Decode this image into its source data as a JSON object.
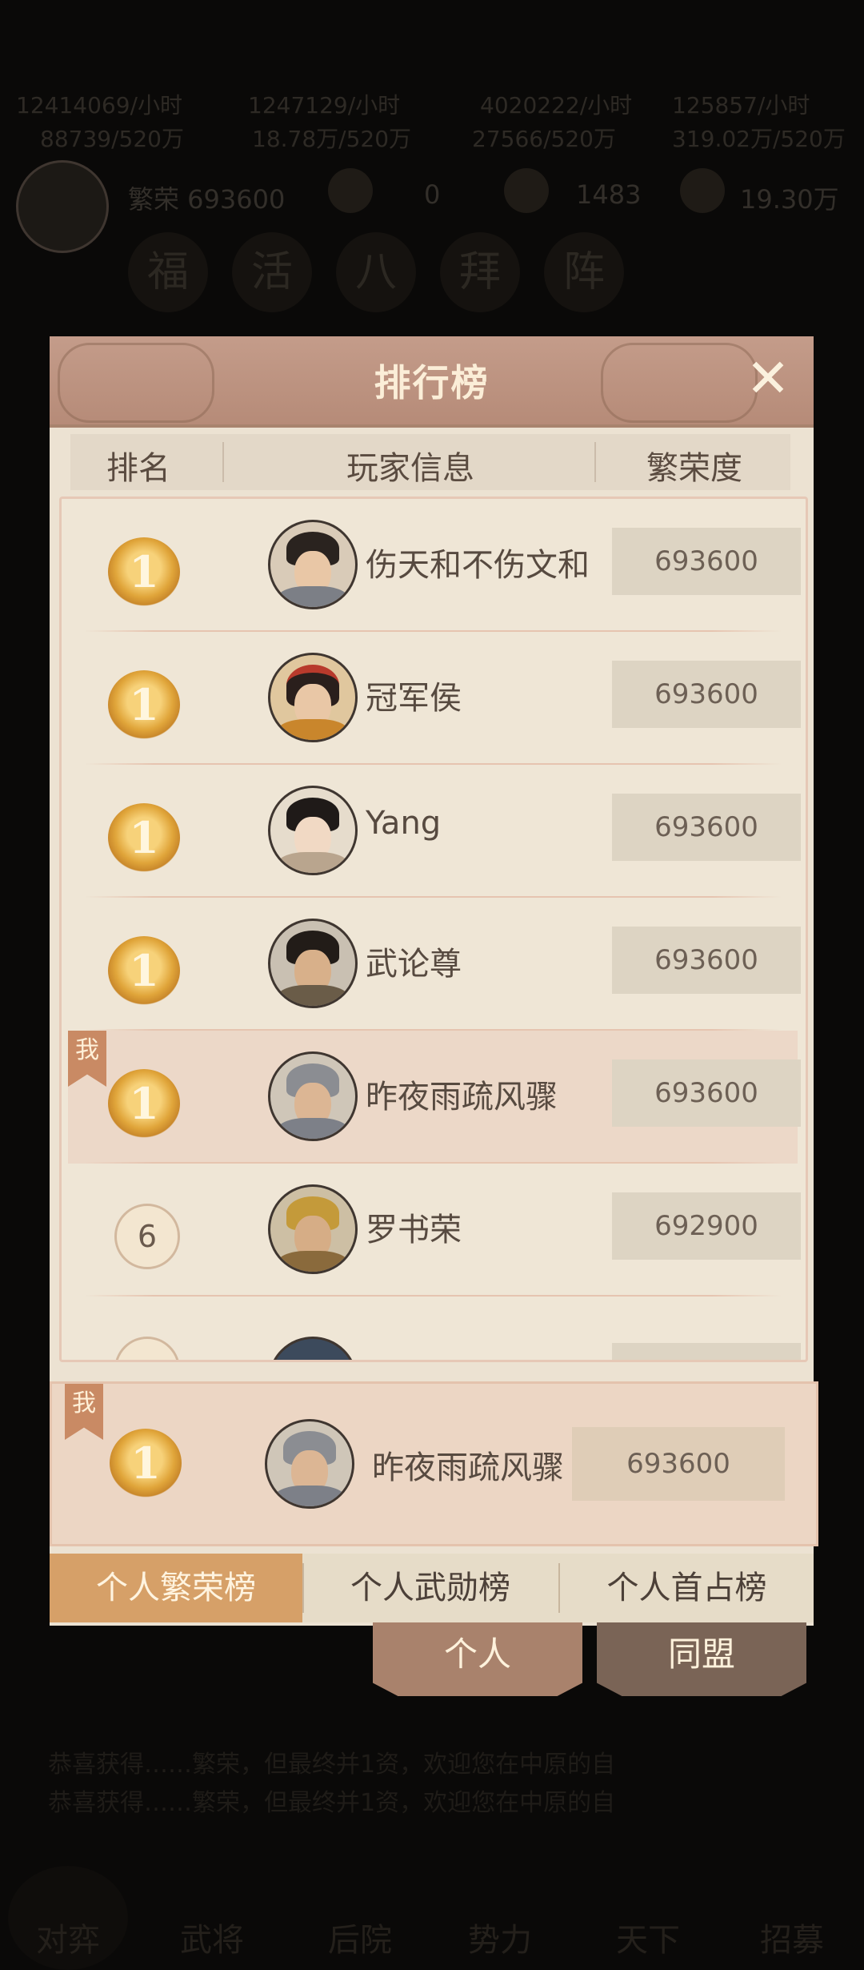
{
  "background": {
    "resources": [
      {
        "rate": "12414069/小时",
        "cap": "88739/520万"
      },
      {
        "rate": "1247129/小时",
        "cap": "18.78万/520万"
      },
      {
        "rate": "4020222/小时",
        "cap": "27566/520万"
      },
      {
        "rate": "125857/小时",
        "cap": "319.02万/520万"
      }
    ],
    "stats": [
      {
        "label": "繁荣 693600"
      },
      {
        "label": "0"
      },
      {
        "label": "1483"
      },
      {
        "label": "19.30万"
      }
    ],
    "icon_row": [
      "福",
      "活",
      "八",
      "拜",
      "阵"
    ],
    "bottom_text": [
      "恭喜获得……繁荣，但最终并1资，欢迎您在中原的自",
      "恭喜获得……繁荣，但最终并1资，欢迎您在中原的自"
    ],
    "nav": [
      "对弈",
      "武将",
      "后院",
      "势力",
      "天下",
      "招募"
    ]
  },
  "modal": {
    "title": "排行榜",
    "close_symbol": "✕",
    "columns": {
      "rank": "排名",
      "player_info": "玩家信息",
      "prosperity": "繁荣度"
    },
    "me_tag": "我",
    "rows": [
      {
        "rank": "1",
        "name": "伤天和不伤文和",
        "score": "693600",
        "me": false
      },
      {
        "rank": "1",
        "name": "冠军侯",
        "score": "693600",
        "me": false
      },
      {
        "rank": "1",
        "name": "Yang",
        "score": "693600",
        "me": false
      },
      {
        "rank": "1",
        "name": "武论尊",
        "score": "693600",
        "me": false
      },
      {
        "rank": "1",
        "name": "昨夜雨疏风骤",
        "score": "693600",
        "me": true
      },
      {
        "rank": "6",
        "name": "罗书荣",
        "score": "692900",
        "me": false
      }
    ],
    "self": {
      "rank": "1",
      "name": "昨夜雨疏风骤",
      "score": "693600"
    },
    "tabs": [
      {
        "label": "个人繁荣榜",
        "active": true
      },
      {
        "label": "个人武勋榜",
        "active": false
      },
      {
        "label": "个人首占榜",
        "active": false
      }
    ]
  },
  "subtabs": [
    {
      "label": "个人",
      "active": true
    },
    {
      "label": "同盟",
      "active": false
    }
  ],
  "colors": {
    "header": "#b68b78",
    "active_tab": "#d6a068",
    "panel": "#ece2d2",
    "medal": "#e0a53a"
  }
}
